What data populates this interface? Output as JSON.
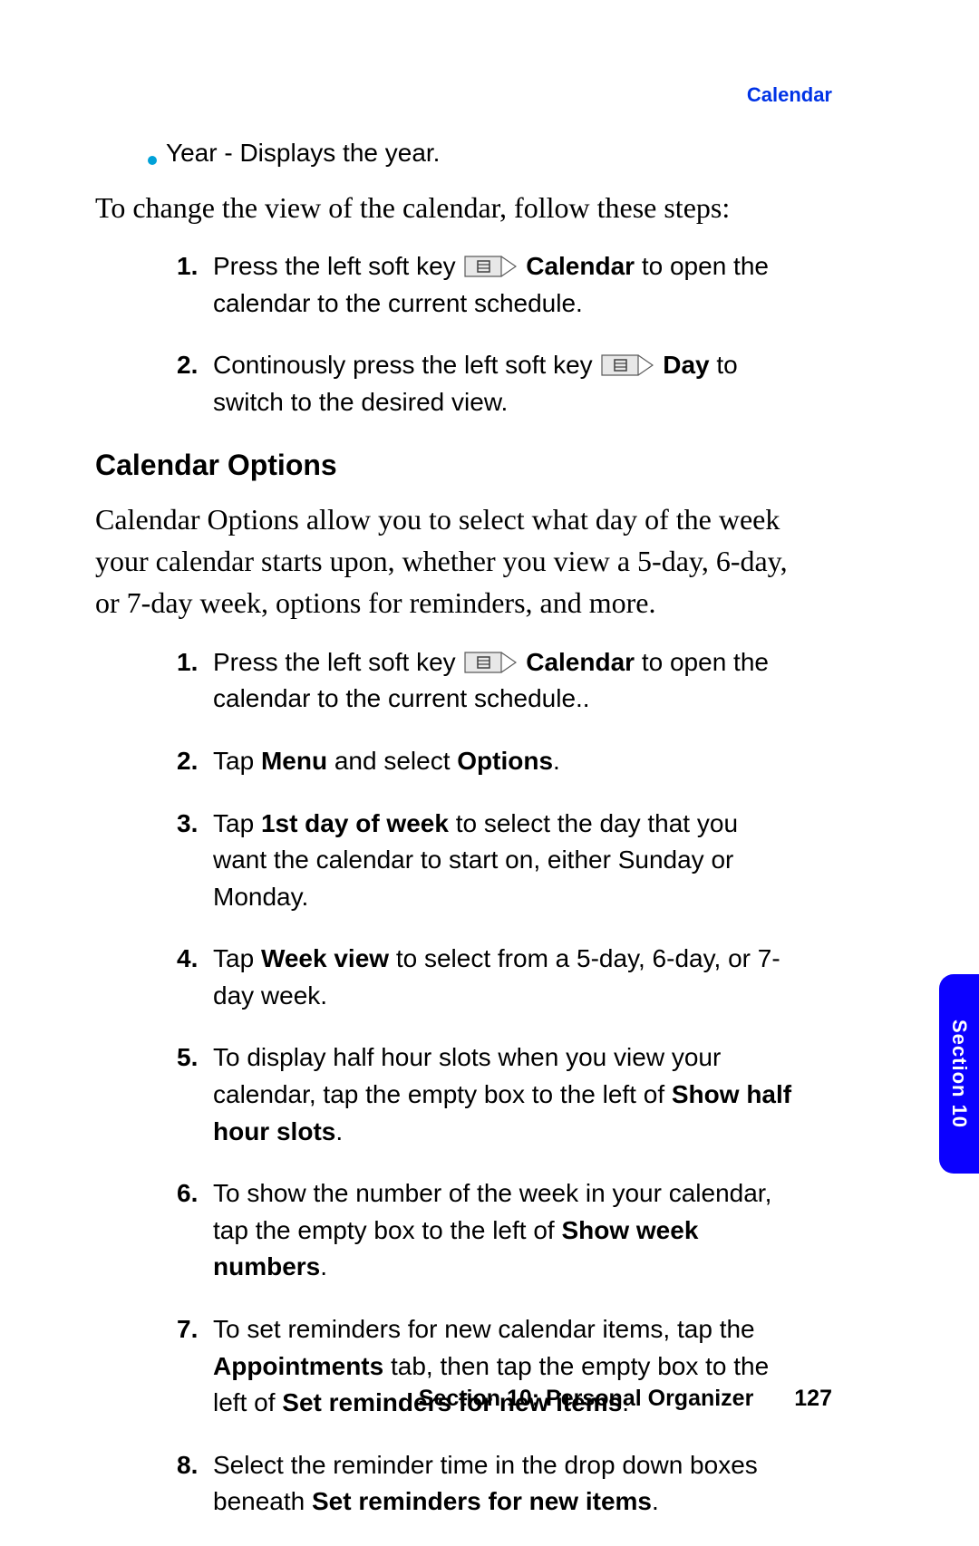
{
  "running_head": "Calendar",
  "bullet": {
    "text": "Year - Displays the year."
  },
  "intro1": "To change the view of the calendar, follow these steps:",
  "steps_a": [
    {
      "num": "1.",
      "pre": "Press the left soft key ",
      "icon": true,
      "bold_after_icon": "Calendar",
      "post": " to open the calendar to the current schedule."
    },
    {
      "num": "2.",
      "pre": "Continously press the left soft key ",
      "icon": true,
      "bold_after_icon": "Day",
      "post": " to switch to the desired view."
    }
  ],
  "subhead": "Calendar Options",
  "intro2": "Calendar Options allow you to select what day of the week your calendar starts upon, whether you view a 5-day, 6-day, or 7-day week, options for reminders, and more.",
  "steps_b": [
    {
      "num": "1.",
      "segments": [
        {
          "t": "Press the left soft key "
        },
        {
          "icon": true
        },
        {
          "t": " "
        },
        {
          "t": "Calendar",
          "b": true
        },
        {
          "t": " to open the calendar to the current schedule.."
        }
      ]
    },
    {
      "num": "2.",
      "segments": [
        {
          "t": "Tap "
        },
        {
          "t": "Menu",
          "b": true
        },
        {
          "t": " and select "
        },
        {
          "t": "Options",
          "b": true
        },
        {
          "t": "."
        }
      ]
    },
    {
      "num": "3.",
      "segments": [
        {
          "t": "Tap "
        },
        {
          "t": "1st day of week",
          "b": true
        },
        {
          "t": " to select the day that you want the calendar to start on, either Sunday or Monday."
        }
      ]
    },
    {
      "num": "4.",
      "segments": [
        {
          "t": "Tap "
        },
        {
          "t": "Week view",
          "b": true
        },
        {
          "t": " to select from a 5-day, 6-day, or 7-day week."
        }
      ]
    },
    {
      "num": "5.",
      "segments": [
        {
          "t": "To display half hour slots when you view your calendar, tap the empty box to the left of "
        },
        {
          "t": "Show half hour slots",
          "b": true
        },
        {
          "t": "."
        }
      ]
    },
    {
      "num": "6.",
      "segments": [
        {
          "t": "To show the number of the week in your calendar, tap the empty box to the left of "
        },
        {
          "t": "Show week numbers",
          "b": true
        },
        {
          "t": "."
        }
      ]
    },
    {
      "num": "7.",
      "segments": [
        {
          "t": "To set reminders for new calendar items, tap the "
        },
        {
          "t": "Appointments",
          "b": true
        },
        {
          "t": " tab, then tap the empty box to the left of "
        },
        {
          "t": "Set reminders for new items",
          "b": true
        },
        {
          "t": "."
        }
      ]
    },
    {
      "num": "8.",
      "segments": [
        {
          "t": "Select the reminder time in the drop down boxes beneath "
        },
        {
          "t": "Set reminders for new items",
          "b": true
        },
        {
          "t": "."
        }
      ]
    }
  ],
  "side_tab": "Section 10",
  "footer": {
    "section": "Section 10: Personal Organizer",
    "page": "127"
  }
}
